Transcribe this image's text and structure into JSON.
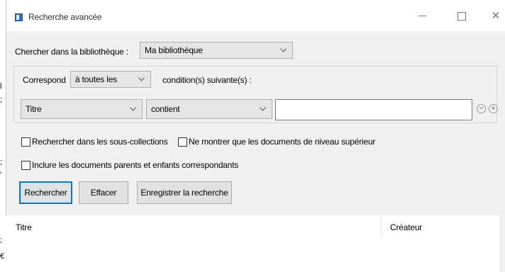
{
  "window": {
    "title": "Recherche avancée"
  },
  "library": {
    "label": "Chercher dans la bibliothèque :",
    "selected": "Ma bibliothèque"
  },
  "match": {
    "label": "Correspond",
    "selected": "à toutes les",
    "suffix": "condition(s) suivante(s) :"
  },
  "condition": {
    "field": "Titre",
    "operator": "contient",
    "value": ""
  },
  "options": {
    "subcollections": "Rechercher dans les sous-collections",
    "top_level": "Ne montrer que les documents de niveau supérieur",
    "include_parents": "Inclure les documents parents et enfants correspondants"
  },
  "buttons": {
    "search": "Rechercher",
    "clear": "Effacer",
    "save": "Enregistrer la recherche"
  },
  "results": {
    "columns": [
      "Titre",
      "Créateur"
    ]
  },
  "icons": {
    "minus": "−",
    "plus": "+",
    "close": "✕"
  }
}
